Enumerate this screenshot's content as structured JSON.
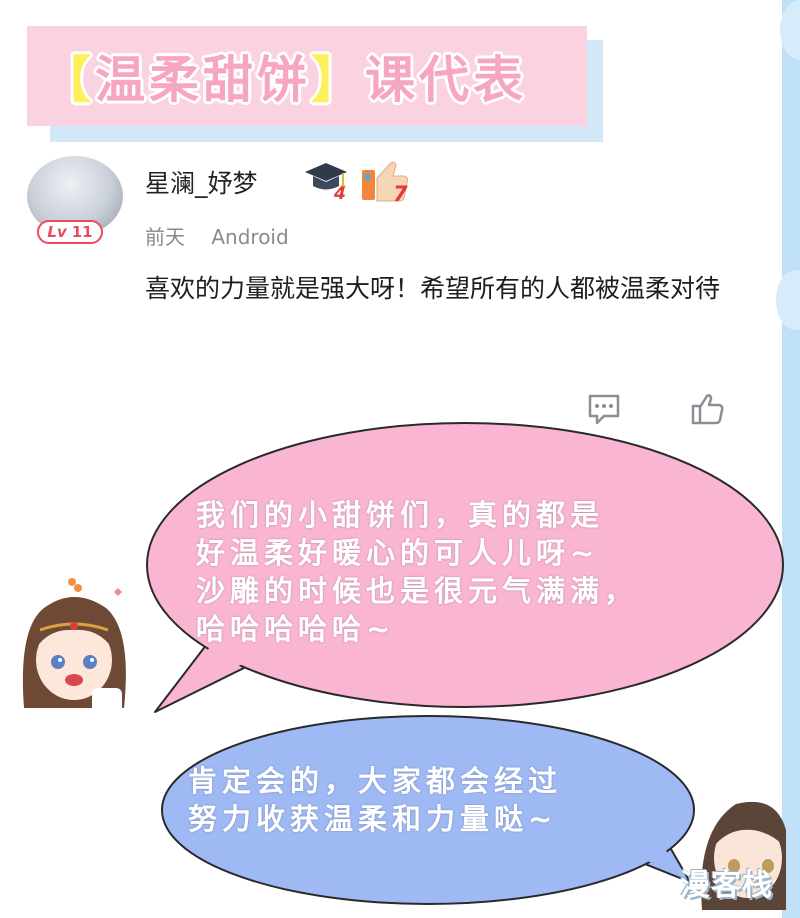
{
  "title": {
    "open_bracket": "【",
    "text": "温柔甜饼",
    "close_bracket": "】",
    "suffix": "课代表"
  },
  "comment": {
    "username": "星澜_妤梦",
    "level_prefix": "Lv",
    "level": "11",
    "badge_grad_count": "4",
    "badge_like_count": "7",
    "time": "前天",
    "device": "Android",
    "body": "喜欢的力量就是强大呀！希望所有的人都被温柔对待"
  },
  "icons": {
    "reply": "comment-icon",
    "like": "thumbs-up-icon"
  },
  "bubbles": {
    "pink_lines": [
      "我们的小甜饼们，真的都是",
      "好温柔好暖心的可人儿呀~",
      "沙雕的时候也是很元气满满，",
      "哈哈哈哈哈~"
    ],
    "blue_lines": [
      "肯定会的，大家都会经过",
      "努力收获温柔和力量哒~"
    ]
  },
  "watermark": "漫客栈",
  "colors": {
    "pink_bubble": "#f9b5d2",
    "blue_bubble": "#9fb9f5",
    "banner": "#fbd3e0",
    "level_red": "#e94b5f"
  }
}
